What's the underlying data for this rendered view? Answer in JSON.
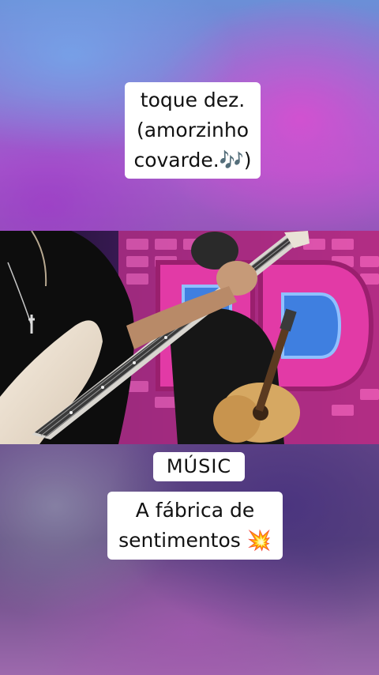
{
  "caption_top": {
    "line1": "toque dez.",
    "line2": "(amorzinho",
    "line3": "covarde.🎶)"
  },
  "caption_music": {
    "label": "MÚSIC"
  },
  "caption_bottom": {
    "line1": "A fábrica de",
    "line2": "sentimentos 💥"
  },
  "video": {
    "description_icon": "guitar-performance-frame"
  },
  "colors": {
    "caption_bg": "#ffffff",
    "caption_text": "#111111",
    "stage_pink": "#e23aa6",
    "stage_blue": "#3f7fe0"
  }
}
